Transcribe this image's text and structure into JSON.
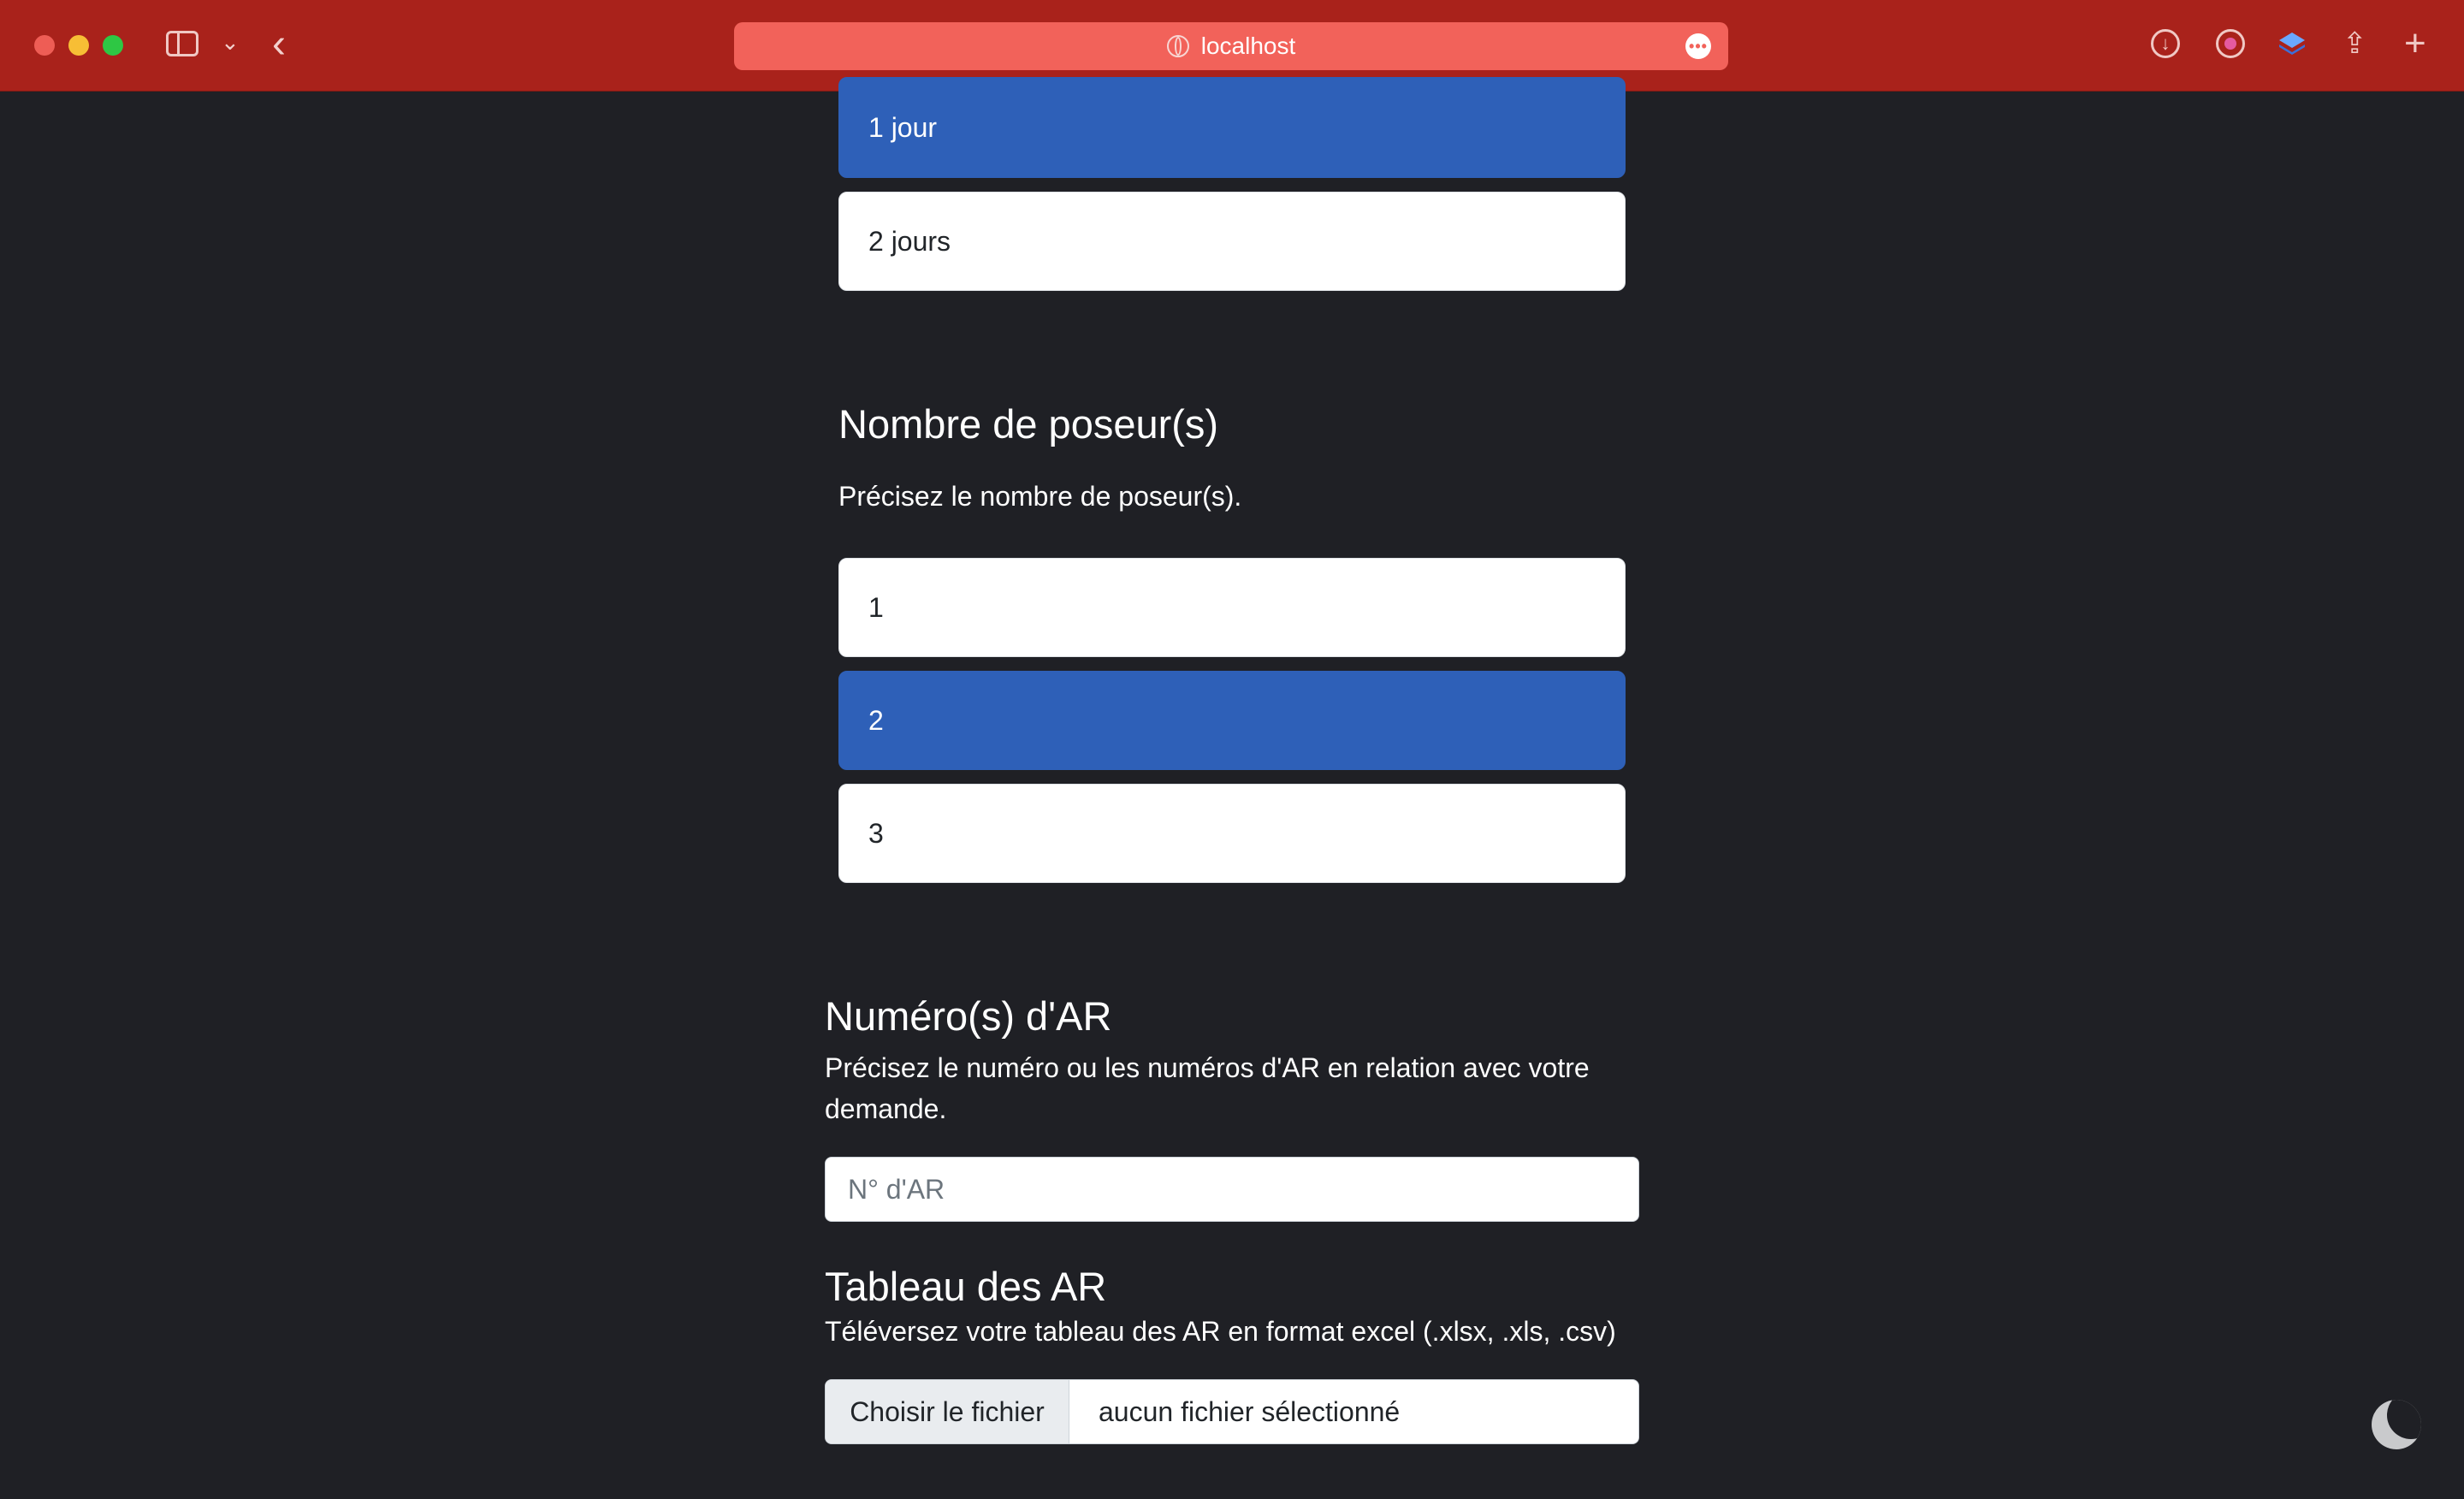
{
  "browser": {
    "url": "localhost"
  },
  "duration_options": [
    {
      "label": "1 jour",
      "selected": true
    },
    {
      "label": "2 jours",
      "selected": false
    }
  ],
  "poseurs": {
    "title": "Nombre de poseur(s)",
    "description": "Précisez le nombre de poseur(s).",
    "options": [
      {
        "label": "1",
        "selected": false
      },
      {
        "label": "2",
        "selected": true
      },
      {
        "label": "3",
        "selected": false
      }
    ]
  },
  "ar_numbers": {
    "title": "Numéro(s) d'AR",
    "description_line1": "Précisez le numéro ou les numéros d'AR en relation avec votre",
    "description_line2": "demande.",
    "placeholder": "N° d'AR"
  },
  "ar_table": {
    "title": "Tableau des AR",
    "description": "Téléversez votre tableau des AR en format excel (.xlsx, .xls, .csv)",
    "button_label": "Choisir le fichier",
    "file_status": "aucun fichier sélectionné"
  },
  "theme_toggle": {
    "icon": "moon-icon"
  },
  "colors": {
    "toolbar": "#a9221b",
    "urlbar": "#f2625a",
    "page_bg": "#1f2025",
    "selected": "#2e60b8"
  }
}
